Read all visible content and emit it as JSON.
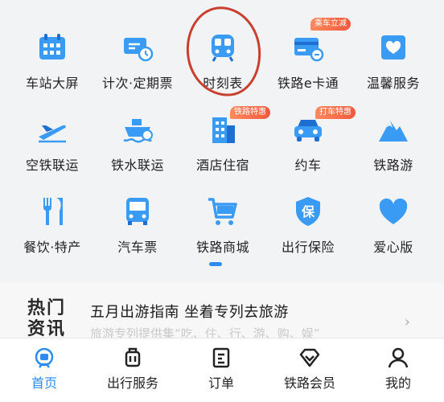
{
  "colors": {
    "accent": "#2d8cf0",
    "badge": "#f2583e",
    "annotation": "#c8402e"
  },
  "services": [
    {
      "label": "车站大屏",
      "icon": "calendar-icon"
    },
    {
      "label": "计次·定期票",
      "icon": "ticket-clock-icon"
    },
    {
      "label": "时刻表",
      "icon": "train-icon"
    },
    {
      "label": "铁路e卡通",
      "icon": "card-icon",
      "badge": "乘车立减"
    },
    {
      "label": "温馨服务",
      "icon": "heart-box-icon"
    },
    {
      "label": "空铁联运",
      "icon": "plane-icon"
    },
    {
      "label": "铁水联运",
      "icon": "ship-icon"
    },
    {
      "label": "酒店住宿",
      "icon": "hotel-icon",
      "badge": "铁路特惠"
    },
    {
      "label": "约车",
      "icon": "car-icon",
      "badge": "打车特惠"
    },
    {
      "label": "铁路游",
      "icon": "mountain-icon"
    },
    {
      "label": "餐饮·特产",
      "icon": "fork-knife-icon"
    },
    {
      "label": "汽车票",
      "icon": "bus-icon"
    },
    {
      "label": "铁路商城",
      "icon": "cart-icon"
    },
    {
      "label": "出行保险",
      "icon": "shield-icon",
      "icon_text": "保"
    },
    {
      "label": "爱心版",
      "icon": "heart-icon"
    }
  ],
  "news": {
    "logo_text": "热门资讯",
    "title": "五月出游指南 坐着专列去旅游",
    "subtitle": "旅游专列提供集“吃、住、行、游、购、娱”",
    "arrow": "›"
  },
  "tabbar": [
    {
      "label": "首页",
      "icon": "home-icon",
      "active": true
    },
    {
      "label": "出行服务",
      "icon": "luggage-icon",
      "active": false
    },
    {
      "label": "订单",
      "icon": "order-icon",
      "active": false
    },
    {
      "label": "铁路会员",
      "icon": "diamond-icon",
      "active": false
    },
    {
      "label": "我的",
      "icon": "user-icon",
      "active": false
    }
  ]
}
